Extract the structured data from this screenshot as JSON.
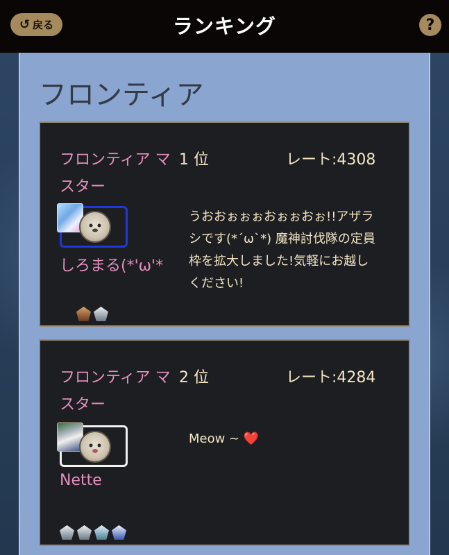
{
  "header": {
    "back_label": "戻る",
    "back_icon": "undo-arrow-icon",
    "title": "ランキング",
    "help_label": "?"
  },
  "section": {
    "title": "フロンティア"
  },
  "rankings": [
    {
      "rank_title": "フロンティアマスター",
      "rank_title_display": "フロンティア マスター",
      "position": "1 位",
      "rate": "レート:4308",
      "player_name": "しろまる(*'ω'*",
      "comment": "うおおぉぉぉおぉぉおぉ!!アザラシです(*´ω`*) 魔神討伐隊の定員枠を拡大しました!気軽にお越しください!",
      "emblems": [
        "bronze-emblem-icon",
        "silver-emblem-icon"
      ]
    },
    {
      "rank_title": "フロンティアマスター",
      "rank_title_display": "フロンティア マスター",
      "position": "2 位",
      "rate": "レート:4284",
      "player_name": "Nette",
      "comment": "Meow ~",
      "comment_emoji": "❤️",
      "emblems": [
        "silver-emblem-icon",
        "silver-emblem-icon",
        "teal-emblem-icon",
        "blue-emblem-icon"
      ]
    }
  ],
  "colors": {
    "topbar": "#0b0606",
    "accent_gold": "#a58a5d",
    "panel": "#8aa5cf",
    "card": "#1d1e22",
    "pink_text": "#e58fbf",
    "cream_text": "#f4e6c4"
  }
}
